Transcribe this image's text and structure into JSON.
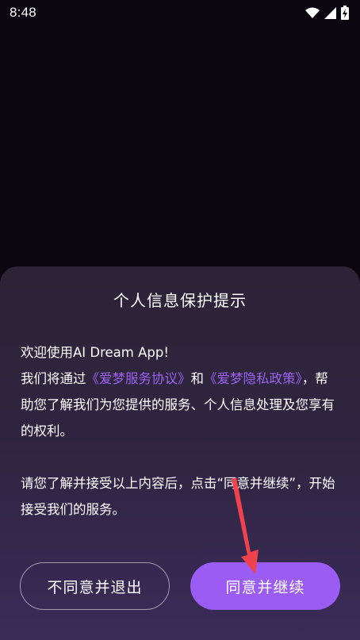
{
  "status_bar": {
    "time": "8:48",
    "icons": [
      "wifi-icon",
      "signal-icon",
      "battery-charging-icon"
    ]
  },
  "dialog": {
    "title": "个人信息保护提示",
    "welcome": "欢迎使用AI Dream App!",
    "intro_prefix": "我们将通过",
    "terms_link": "《爱梦服务协议》",
    "conjunction": "和",
    "privacy_link": "《爱梦隐私政策》",
    "intro_suffix": "，帮助您了解我们为您提供的服务、个人信息处理及您享有的权利。",
    "instruction": "请您了解并接受以上内容后，点击“同意并继续”，开始接受我们的服务。",
    "decline_label": "不同意并退出",
    "accept_label": "同意并继续"
  },
  "colors": {
    "link": "#9b63f2",
    "accept_button": "#9a5cf2",
    "annotation_arrow": "#f0424c"
  }
}
